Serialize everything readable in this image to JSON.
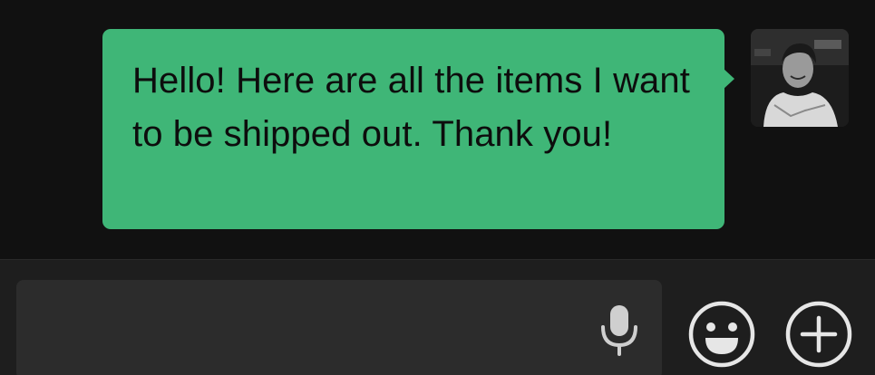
{
  "chat": {
    "messages": [
      {
        "sender": "self",
        "text": "Hello! Here are all the items I want to be shipped out. Thank you!"
      }
    ],
    "bubble_color": "#3fb677",
    "avatar_icon": "user-photo-avatar"
  },
  "composer": {
    "input_value": "",
    "icons": {
      "mic": "microphone-icon",
      "emoji": "smiley-face-icon",
      "add": "plus-circle-icon"
    }
  },
  "theme": {
    "background": "#111111",
    "input_bar": "#1e1e1e",
    "icon_color": "#d9d9d9"
  }
}
